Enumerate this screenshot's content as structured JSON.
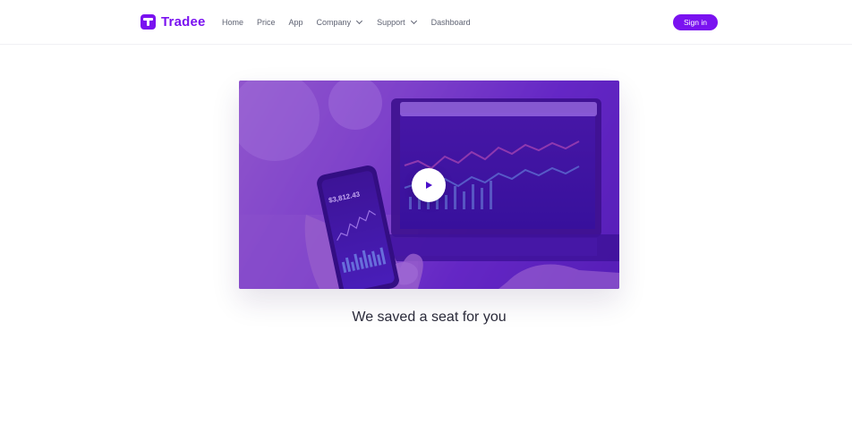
{
  "brand": {
    "name": "Tradee"
  },
  "nav": {
    "items": [
      {
        "label": "Home"
      },
      {
        "label": "Price"
      },
      {
        "label": "App"
      },
      {
        "label": "Company"
      },
      {
        "label": "Support"
      },
      {
        "label": "Dashboard"
      }
    ]
  },
  "header": {
    "signin_label": "Sign in"
  },
  "video": {
    "phone_balance": "$3,812.43",
    "play_icon": "play-icon",
    "overlay_color": "#5b12d6"
  },
  "main": {
    "caption": "We saved a seat for you"
  },
  "colors": {
    "accent": "#7a12f0",
    "nav_text": "#5f6373",
    "heading": "#2a2a3a"
  }
}
